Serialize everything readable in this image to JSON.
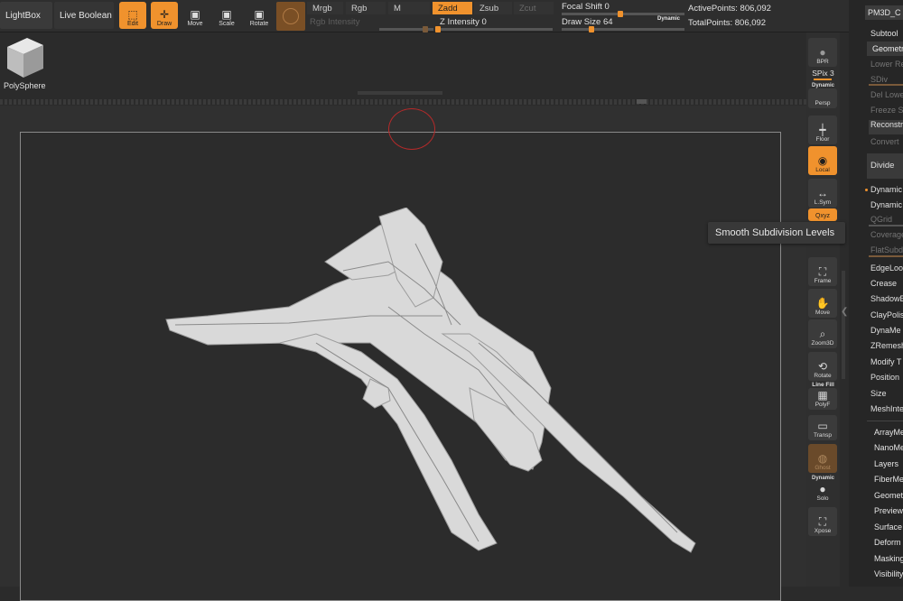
{
  "topbar": {
    "lightbox": "LightBox",
    "live_boolean": "Live Boolean",
    "tools": [
      {
        "label": "Edit",
        "icon": "edit-icon",
        "active": true
      },
      {
        "label": "Draw",
        "icon": "draw-icon",
        "active": true
      },
      {
        "label": "Move",
        "icon": "move-icon",
        "active": false
      },
      {
        "label": "Scale",
        "icon": "scale-icon",
        "active": false
      },
      {
        "label": "Rotate",
        "icon": "rotate-icon",
        "active": false
      }
    ],
    "channels": {
      "mrgb": "Mrgb",
      "rgb": "Rgb",
      "m": "M",
      "zadd": "Zadd",
      "zsub": "Zsub",
      "zcut": "Zcut",
      "rgb_intensity": "Rgb Intensity",
      "z_intensity_label": "Z Intensity",
      "z_intensity_value": "0"
    },
    "focal_shift_label": "Focal Shift",
    "focal_shift_value": "0",
    "draw_size_label": "Draw Size",
    "draw_size_value": "64",
    "dynamic": "Dynamic",
    "active_points": "ActivePoints: 806,092",
    "total_points": "TotalPoints: 806,092",
    "accent": "#f0922d"
  },
  "tool_thumb": {
    "label": "PolySphere"
  },
  "shelf": {
    "bpr": "BPR",
    "spix": "SPix 3",
    "dynamic": "Dynamic",
    "persp": "Persp",
    "floor": "Floor",
    "local": "Local",
    "lsym": "L.Sym",
    "xyz": "Qxyz",
    "frame": "Frame",
    "move": "Move",
    "zoom3d": "Zoom3D",
    "rotate": "Rotate",
    "line_fill": "Line Fill",
    "polyf": "PolyF",
    "transp": "Transp",
    "ghost": "Ghost",
    "solo_dynamic": "Dynamic",
    "solo": "Solo",
    "xpose": "Xpose"
  },
  "tooltip": "Smooth Subdivision Levels",
  "panel": {
    "title": "PM3D_C",
    "subtool": "Subtool",
    "geometry": "Geometr",
    "rows": [
      {
        "label": "Lower Re",
        "dim": true
      },
      {
        "label": "SDiv",
        "dim": true
      },
      {
        "label": "Del Lowe",
        "dim": true
      },
      {
        "label": "Freeze S",
        "dim": true
      },
      {
        "label": "Reconstr",
        "dim": false
      },
      {
        "label": "Convert",
        "dim": true
      },
      {
        "label": "Divide",
        "dim": false
      },
      {
        "label": "Dynamic",
        "dim": false
      },
      {
        "label": "Dynamic",
        "dim": false
      },
      {
        "label": "QGrid",
        "dim": true
      },
      {
        "label": "Coverage",
        "dim": true
      },
      {
        "label": "FlatSubd",
        "dim": true
      },
      {
        "label": "EdgeLoo",
        "dim": false
      },
      {
        "label": "Crease",
        "dim": false
      },
      {
        "label": "ShadowB",
        "dim": false
      },
      {
        "label": "ClayPolis",
        "dim": false
      },
      {
        "label": "DynaMe",
        "dim": false
      },
      {
        "label": "ZRemesh",
        "dim": false
      },
      {
        "label": "Modify T",
        "dim": false
      },
      {
        "label": "Position",
        "dim": false
      },
      {
        "label": "Size",
        "dim": false
      },
      {
        "label": "MeshInte",
        "dim": false
      }
    ],
    "menus": [
      "ArrayMe",
      "NanoMe",
      "Layers",
      "FiberMe",
      "Geomet",
      "Preview",
      "Surface",
      "Deform",
      "Masking",
      "Visibility"
    ]
  }
}
